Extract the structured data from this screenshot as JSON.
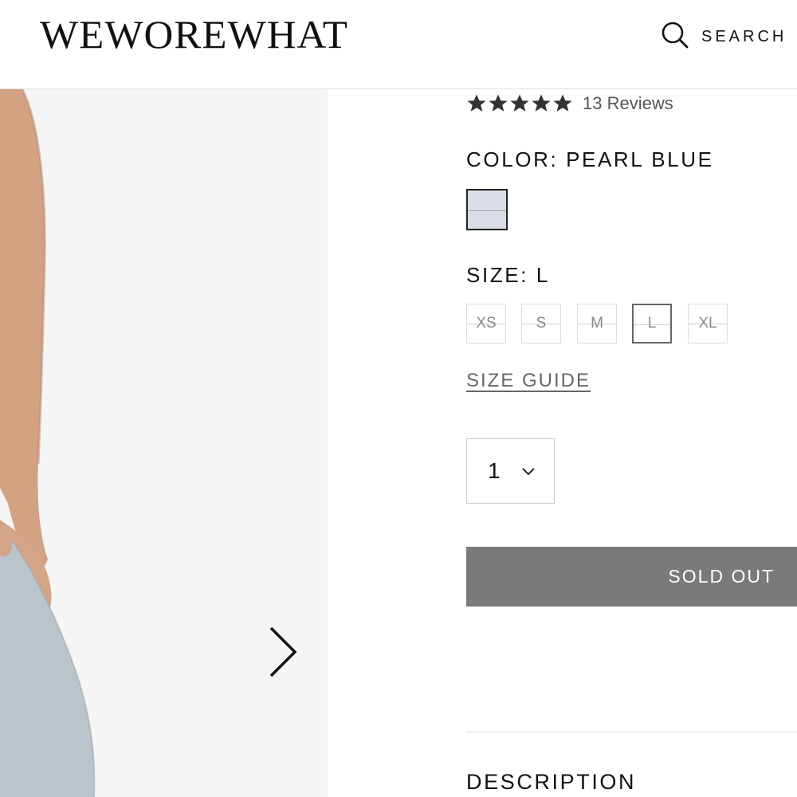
{
  "header": {
    "logo": "WEWOREWHAT",
    "search_label": "SEARCH",
    "search_icon": "search-icon"
  },
  "gallery": {
    "next_icon": "chevron-right-icon"
  },
  "product": {
    "rating": 5,
    "reviews_text": "13 Reviews",
    "color_label": "COLOR: PEARL BLUE",
    "swatch_color": "#d9dee6",
    "size_label": "SIZE: L",
    "sizes": [
      "XS",
      "S",
      "M",
      "L",
      "XL"
    ],
    "selected_size": "L",
    "size_guide": "SIZE GUIDE",
    "quantity": "1",
    "sold_out_label": "SOLD OUT",
    "description_heading": "DESCRIPTION"
  },
  "colors": {
    "button_gray": "#7a7a7a",
    "background": "#ffffff",
    "image_background": "#f5f5f5"
  }
}
